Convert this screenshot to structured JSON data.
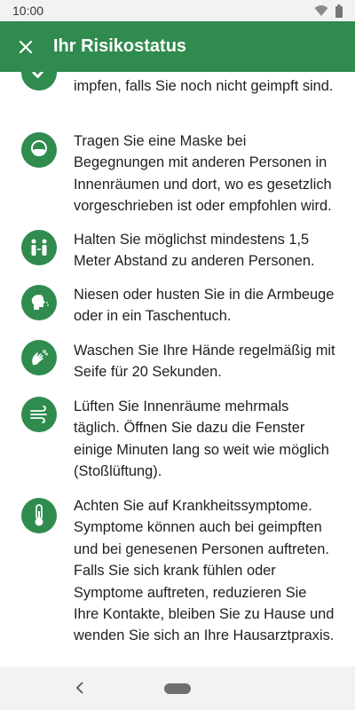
{
  "status_bar": {
    "time": "10:00"
  },
  "app_bar": {
    "title": "Ihr Risikostatus",
    "close_icon": "close-icon"
  },
  "tips": [
    {
      "icon": "check-icon",
      "text": "impfen, falls Sie noch nicht geimpft sind."
    },
    {
      "icon": "face-mask-icon",
      "text": "Tragen Sie eine Maske bei Begegnungen mit anderen Personen in Innenräumen und dort, wo es gesetzlich vorgeschrieben ist oder empfohlen wird."
    },
    {
      "icon": "distance-icon",
      "text": "Halten Sie möglichst mindestens 1,5 Meter Abstand zu anderen Personen."
    },
    {
      "icon": "sneeze-icon",
      "text": "Niesen oder husten Sie in die Armbeuge oder in ein Taschentuch."
    },
    {
      "icon": "hand-wash-icon",
      "text": "Waschen Sie Ihre Hände regelmäßig mit Seife für 20 Sekunden."
    },
    {
      "icon": "air-icon",
      "text": "Lüften Sie Innenräume mehrmals täglich. Öffnen Sie dazu die Fenster einige Minuten lang so weit wie möglich (Stoßlüftung)."
    },
    {
      "icon": "thermometer-icon",
      "text": "Achten Sie auf Krankheitssymptome. Symptome können auch bei geimpften und bei genesenen Personen auftreten. Falls Sie sich krank fühlen oder Symptome auftreten, reduzieren Sie Ihre Kontakte, bleiben Sie zu Hause und wenden Sie sich an Ihre Hausarztpraxis."
    }
  ],
  "colors": {
    "primary": "#2f8b4e",
    "statusbar": "#f2f2f2",
    "text": "#1f1f1f"
  }
}
